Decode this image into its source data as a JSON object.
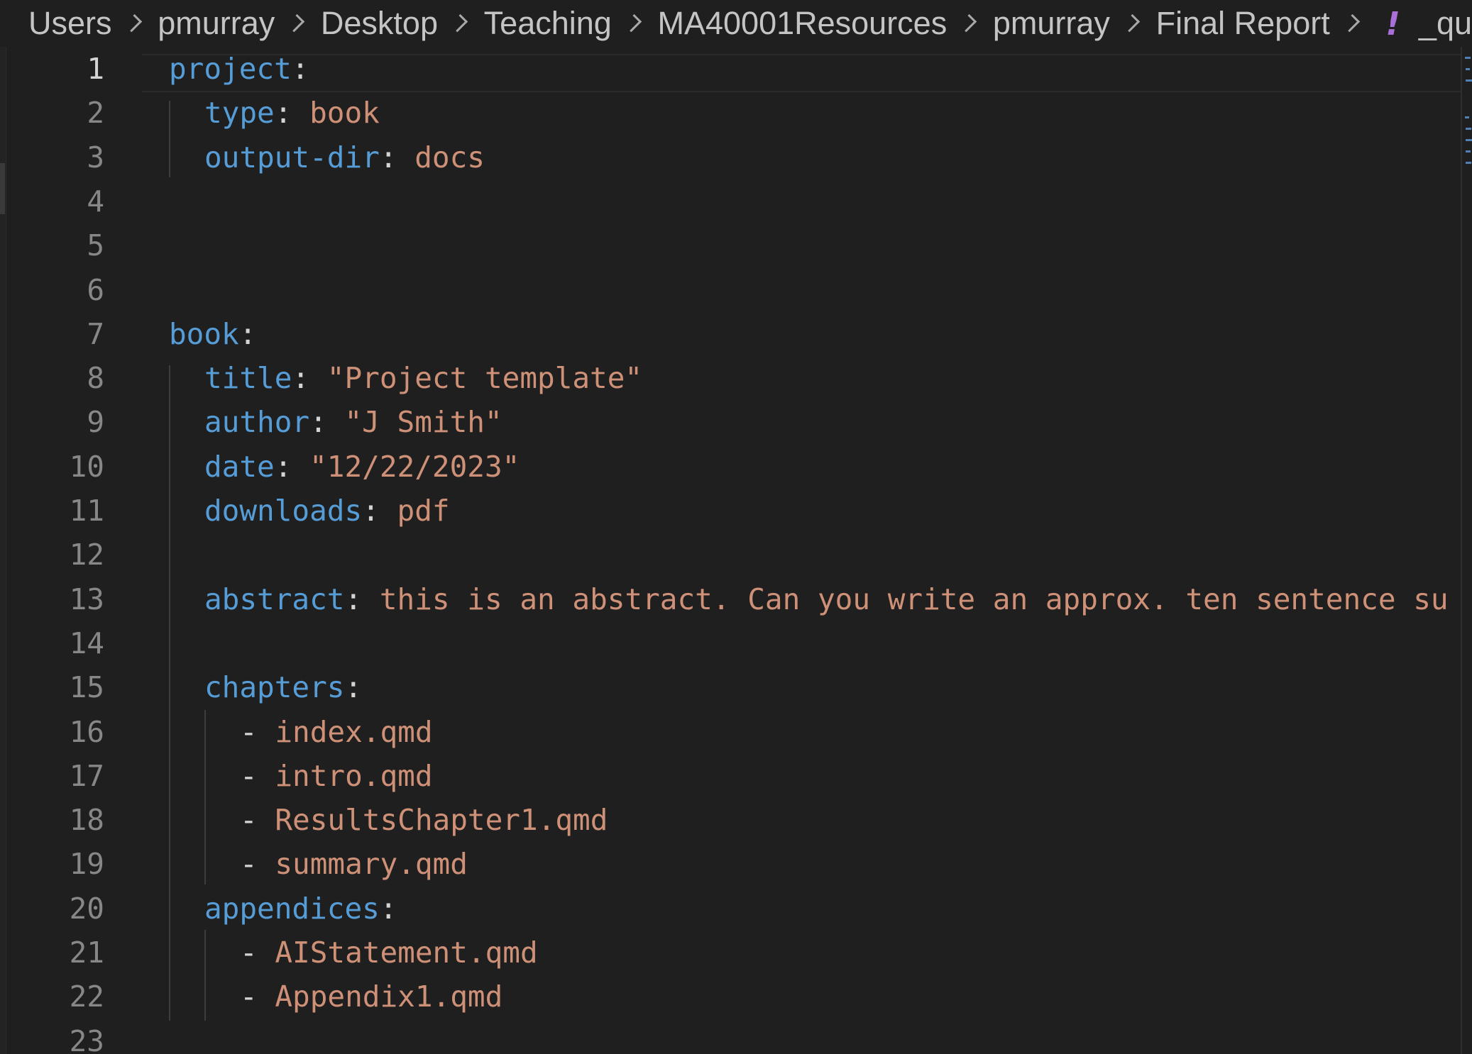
{
  "breadcrumb": {
    "items": [
      "Users",
      "pmurray",
      "Desktop",
      "Teaching",
      "MA40001Resources",
      "pmurray",
      "Final Report"
    ],
    "file_icon": "!",
    "file_name": "_qu"
  },
  "colors": {
    "background": "#1f1f1f",
    "key": "#569cd6",
    "value": "#ce9178",
    "punctuation": "#d4d4d4",
    "line_number": "#878787",
    "yaml_icon": "#a970d9"
  },
  "editor": {
    "active_line": 1,
    "lines": [
      {
        "n": "1",
        "key": "project",
        "colon": ":",
        "value": ""
      },
      {
        "n": "2",
        "key": "type",
        "colon": ": ",
        "value": "book"
      },
      {
        "n": "3",
        "key": "output-dir",
        "colon": ": ",
        "value": "docs"
      },
      {
        "n": "4",
        "key": "",
        "colon": "",
        "value": ""
      },
      {
        "n": "5",
        "key": "",
        "colon": "",
        "value": ""
      },
      {
        "n": "6",
        "key": "",
        "colon": "",
        "value": ""
      },
      {
        "n": "7",
        "key": "book",
        "colon": ":",
        "value": ""
      },
      {
        "n": "8",
        "key": "title",
        "colon": ": ",
        "value": "\"Project template\""
      },
      {
        "n": "9",
        "key": "author",
        "colon": ": ",
        "value": "\"J Smith\""
      },
      {
        "n": "10",
        "key": "date",
        "colon": ": ",
        "value": "\"12/22/2023\""
      },
      {
        "n": "11",
        "key": "downloads",
        "colon": ": ",
        "value": "pdf"
      },
      {
        "n": "12",
        "key": "",
        "colon": "",
        "value": ""
      },
      {
        "n": "13",
        "key": "abstract",
        "colon": ": ",
        "value": "this is an abstract. Can you write an approx. ten sentence su"
      },
      {
        "n": "14",
        "key": "",
        "colon": "",
        "value": ""
      },
      {
        "n": "15",
        "key": "chapters",
        "colon": ":",
        "value": ""
      },
      {
        "n": "16",
        "key": "",
        "colon": "- ",
        "value": "index.qmd"
      },
      {
        "n": "17",
        "key": "",
        "colon": "- ",
        "value": "intro.qmd"
      },
      {
        "n": "18",
        "key": "",
        "colon": "- ",
        "value": "ResultsChapter1.qmd"
      },
      {
        "n": "19",
        "key": "",
        "colon": "- ",
        "value": "summary.qmd"
      },
      {
        "n": "20",
        "key": "appendices",
        "colon": ":",
        "value": ""
      },
      {
        "n": "21",
        "key": "",
        "colon": "- ",
        "value": "AIStatement.qmd"
      },
      {
        "n": "22",
        "key": "",
        "colon": "- ",
        "value": "Appendix1.qmd"
      },
      {
        "n": "23",
        "key": "",
        "colon": "",
        "value": ""
      }
    ]
  }
}
